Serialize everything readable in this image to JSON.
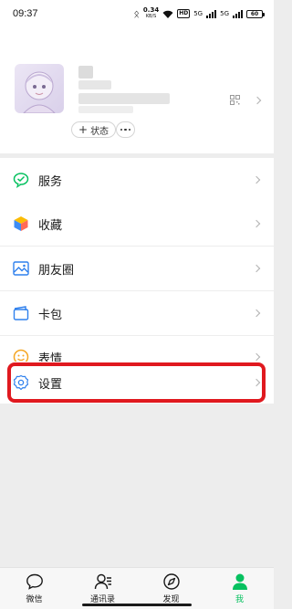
{
  "status_bar": {
    "time": "09:37",
    "net_speed": "0.34",
    "net_unit": "KB/S",
    "hd": "HD",
    "sig1": "5G",
    "sig2": "5G",
    "battery": "60"
  },
  "profile": {
    "status_label": "状态",
    "status_plus": "+"
  },
  "menu": [
    {
      "label": "服务",
      "icon": "service-icon"
    },
    {
      "label": "收藏",
      "icon": "favorites-icon"
    },
    {
      "label": "朋友圈",
      "icon": "moments-icon"
    },
    {
      "label": "卡包",
      "icon": "card-wallet-icon"
    },
    {
      "label": "表情",
      "icon": "stickers-icon"
    },
    {
      "label": "设置",
      "icon": "settings-icon"
    }
  ],
  "tabbar": [
    {
      "label": "微信",
      "icon": "chat-icon"
    },
    {
      "label": "通讯录",
      "icon": "contacts-icon"
    },
    {
      "label": "发现",
      "icon": "discover-icon"
    },
    {
      "label": "我",
      "icon": "me-icon",
      "active": true
    }
  ],
  "colors": {
    "accent": "#07c160",
    "highlight": "#e0191f",
    "background": "#ededed"
  }
}
